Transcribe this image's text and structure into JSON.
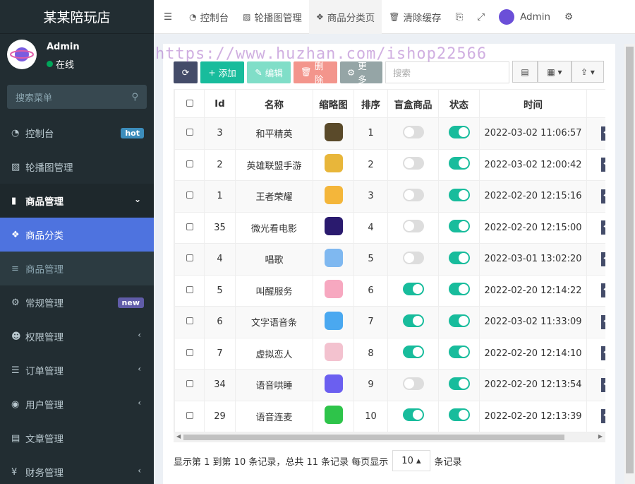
{
  "app": {
    "title": "某某陪玩店"
  },
  "user": {
    "name": "Admin",
    "status": "在线"
  },
  "sidebar": {
    "search_placeholder": "搜索菜单",
    "items": [
      {
        "label": "控制台",
        "icon": "dashboard-icon",
        "badge": "hot",
        "badge_color": "#3c8dbc"
      },
      {
        "label": "轮播图管理",
        "icon": "image-icon"
      },
      {
        "label": "商品管理",
        "icon": "book-icon"
      },
      {
        "label": "商品分类",
        "icon": "cubes-icon"
      },
      {
        "label": "商品管理",
        "icon": "list-icon"
      },
      {
        "label": "常规管理",
        "icon": "cogs-icon",
        "badge": "new",
        "badge_color": "#605ca8"
      },
      {
        "label": "权限管理",
        "icon": "users-icon"
      },
      {
        "label": "订单管理",
        "icon": "list-icon"
      },
      {
        "label": "用户管理",
        "icon": "user-circle-icon"
      },
      {
        "label": "文章管理",
        "icon": "newspaper-icon"
      },
      {
        "label": "财务管理",
        "icon": "yen-icon"
      }
    ]
  },
  "topbar": {
    "tabs": [
      {
        "label": "控制台",
        "icon": "dashboard-icon"
      },
      {
        "label": "轮播图管理",
        "icon": "image-icon"
      },
      {
        "label": "商品分类页",
        "icon": "cubes-icon"
      },
      {
        "label": "清除缓存",
        "icon": "trash-icon"
      }
    ],
    "user_label": "Admin"
  },
  "toolbar": {
    "add": "添加",
    "edit": "编辑",
    "delete": "删除",
    "more": "更多",
    "search_placeholder": "搜索"
  },
  "table": {
    "headers": [
      "Id",
      "名称",
      "缩略图",
      "排序",
      "盲盒商品",
      "状态",
      "时间"
    ],
    "rows": [
      {
        "id": "3",
        "name": "和平精英",
        "thumb_color": "#5a4a2a",
        "sort": "1",
        "blind": false,
        "status": true,
        "time": "2022-03-02 11:06:57"
      },
      {
        "id": "2",
        "name": "英雄联盟手游",
        "thumb_color": "#e8b63a",
        "sort": "2",
        "blind": false,
        "status": true,
        "time": "2022-03-02 12:00:42"
      },
      {
        "id": "1",
        "name": "王者荣耀",
        "thumb_color": "#f4b63a",
        "sort": "3",
        "blind": false,
        "status": true,
        "time": "2022-02-20 12:15:16"
      },
      {
        "id": "35",
        "name": "微光看电影",
        "thumb_color": "#2a1a6e",
        "sort": "4",
        "blind": false,
        "status": true,
        "time": "2022-02-20 12:15:00"
      },
      {
        "id": "4",
        "name": "唱歌",
        "thumb_color": "#7fb8f0",
        "sort": "5",
        "blind": false,
        "status": true,
        "time": "2022-03-01 13:02:20"
      },
      {
        "id": "5",
        "name": "叫醒服务",
        "thumb_color": "#f7a8c0",
        "sort": "6",
        "blind": true,
        "status": true,
        "time": "2022-02-20 12:14:22"
      },
      {
        "id": "6",
        "name": "文字语音条",
        "thumb_color": "#4aa8f0",
        "sort": "7",
        "blind": true,
        "status": true,
        "time": "2022-03-02 11:33:09"
      },
      {
        "id": "7",
        "name": "虚拟恋人",
        "thumb_color": "#f3c2cf",
        "sort": "8",
        "blind": true,
        "status": true,
        "time": "2022-02-20 12:14:10"
      },
      {
        "id": "34",
        "name": "语音哄睡",
        "thumb_color": "#6b5ff0",
        "sort": "9",
        "blind": false,
        "status": true,
        "time": "2022-02-20 12:13:54"
      },
      {
        "id": "29",
        "name": "语音连麦",
        "thumb_color": "#2ec44a",
        "sort": "10",
        "blind": true,
        "status": true,
        "time": "2022-02-20 12:13:39"
      }
    ]
  },
  "footer": {
    "summary": "显示第 1 到第 10 条记录，总共 11 条记录 每页显示",
    "page_size": "10",
    "suffix": "条记录"
  },
  "watermark": "https://www.huzhan.com/ishop22566",
  "colors": {
    "primary": "#18bc9c",
    "active_menu": "#4e73df",
    "sidebar": "#222d32"
  }
}
